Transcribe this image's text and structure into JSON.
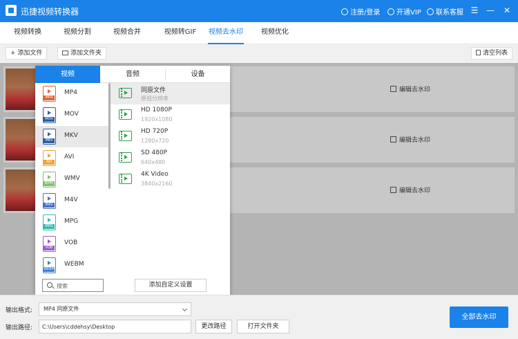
{
  "titlebar": {
    "title": "迅捷视频转换器",
    "login": "注册/登录",
    "vip": "开通VIP",
    "support": "联系客服",
    "menu_glyph": "☰",
    "minimize_glyph": "—",
    "close_glyph": "✕"
  },
  "tabs": [
    {
      "label": "视频转换"
    },
    {
      "label": "视频分割"
    },
    {
      "label": "视频合并"
    },
    {
      "label": "视频转GIF"
    },
    {
      "label": "视频去水印"
    },
    {
      "label": "视频优化"
    }
  ],
  "toolbar": {
    "add_file": "+ 添加文件",
    "add_folder": "添加文件夹",
    "clear_list": "清空列表"
  },
  "rows": [
    {
      "edit_label": "编辑去水印"
    },
    {
      "edit_label": "编辑去水印"
    },
    {
      "edit_label": "编辑去水印"
    }
  ],
  "popup": {
    "tabs": [
      {
        "label": "视频"
      },
      {
        "label": "音频"
      },
      {
        "label": "设备"
      }
    ],
    "formats": [
      {
        "label": "MP4",
        "tag": "MP4",
        "color": "#e2622e"
      },
      {
        "label": "MOV",
        "tag": "MOV",
        "color": "#2b5d9f"
      },
      {
        "label": "MKV",
        "tag": "MKV",
        "color": "#2b5d9f"
      },
      {
        "label": "AVI",
        "tag": "AVI",
        "color": "#f0a23a"
      },
      {
        "label": "WMV",
        "tag": "WMV",
        "color": "#7cc06b"
      },
      {
        "label": "M4V",
        "tag": "M4V",
        "color": "#4a6fc8"
      },
      {
        "label": "MPG",
        "tag": "MPG",
        "color": "#36b8b0"
      },
      {
        "label": "VOB",
        "tag": "VOB",
        "color": "#9a5cd0"
      },
      {
        "label": "WEBM",
        "tag": "WEBM",
        "color": "#3a7fd6"
      }
    ],
    "selected_format_index": 2,
    "qualities": [
      {
        "title": "同原文件",
        "sub": "原视分辨率"
      },
      {
        "title": "HD 1080P",
        "sub": "1920x1080"
      },
      {
        "title": "HD 720P",
        "sub": "1280x720"
      },
      {
        "title": "SD 480P",
        "sub": "640x480"
      },
      {
        "title": "4K Video",
        "sub": "3840x2160"
      }
    ],
    "search_placeholder": "搜索",
    "custom_button": "添加自定义设置"
  },
  "bottom": {
    "format_label": "输出格式:",
    "format_value": "MP4  同原文件",
    "path_label": "输出路径:",
    "path_value": "C:\\Users\\cddehsy\\Desktop",
    "change_path": "更改路径",
    "open_folder": "打开文件夹",
    "primary": "全部去水印"
  },
  "colors": {
    "accent": "#1a82e8",
    "quality_icon": "#2aa04a"
  }
}
